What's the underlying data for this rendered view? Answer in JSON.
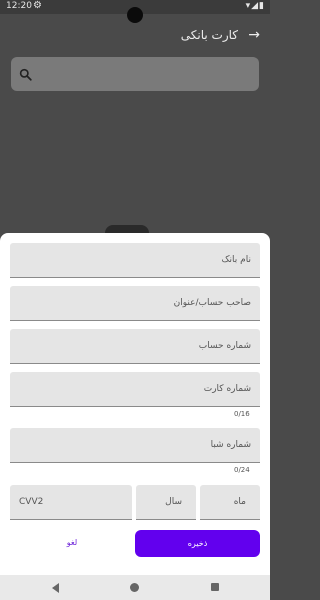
{
  "status_bar": {
    "time": "12:20"
  },
  "app_bar": {
    "title": "کارت بانکی"
  },
  "form": {
    "bank_name": {
      "label": "نام بانک"
    },
    "owner": {
      "label": "صاحب حساب/عنوان"
    },
    "account_number": {
      "label": "شماره حساب"
    },
    "card_number": {
      "label": "شماره کارت",
      "counter": "0/16"
    },
    "sheba": {
      "label": "شماره شبا",
      "counter": "0/24"
    },
    "month": {
      "label": "ماه"
    },
    "year": {
      "label": "سال"
    },
    "cvv2": {
      "label": "CVV2"
    }
  },
  "actions": {
    "save_label": "ذخیره",
    "cancel_label": "لغو"
  },
  "colors": {
    "primary": "#6200ee",
    "scrim": "#4a4a4a"
  }
}
